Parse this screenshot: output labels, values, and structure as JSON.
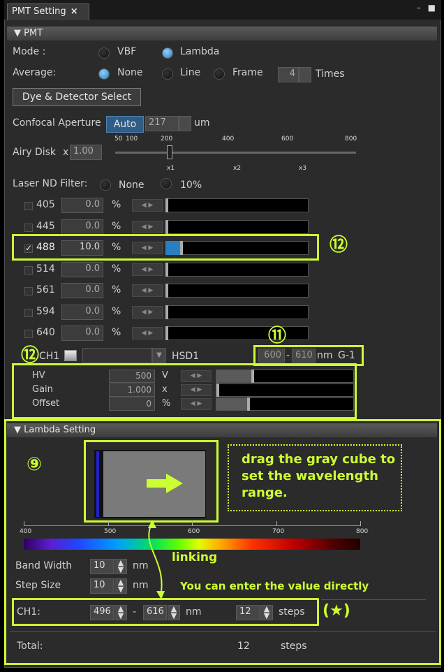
{
  "tab": {
    "title": "PMT Setting",
    "close": "×"
  },
  "window_controls": {
    "min": "–",
    "max": "■"
  },
  "pmt": {
    "section_title": "PMT",
    "mode_label": "Mode :",
    "mode_options": [
      "VBF",
      "Lambda"
    ],
    "mode_selected": "Lambda",
    "average_label": "Average:",
    "average_options": [
      "None",
      "Line",
      "Frame"
    ],
    "average_selected": "None",
    "average_times_value": "4",
    "average_times_unit": "Times",
    "dye_button": "Dye & Detector Select",
    "confocal_label": "Confocal Aperture",
    "confocal_auto": "Auto",
    "confocal_value": "217",
    "confocal_unit": "um",
    "airy_label": "Airy Disk",
    "airy_prefix": "x",
    "airy_value": "1.00",
    "airy_scale_top": [
      "50",
      "100",
      "200",
      "400",
      "600",
      "800"
    ],
    "airy_scale_bottom": [
      "x1",
      "x2",
      "x3"
    ],
    "nd_label": "Laser ND Filter:",
    "nd_options": [
      "None",
      "10%"
    ],
    "nd_selected": "None",
    "lasers": [
      {
        "wavelength": "405",
        "value": "0.0",
        "unit": "%",
        "checked": false,
        "level": 0.0
      },
      {
        "wavelength": "445",
        "value": "0.0",
        "unit": "%",
        "checked": false,
        "level": 0.0
      },
      {
        "wavelength": "488",
        "value": "10.0",
        "unit": "%",
        "checked": true,
        "level": 0.1
      },
      {
        "wavelength": "514",
        "value": "0.0",
        "unit": "%",
        "checked": false,
        "level": 0.0
      },
      {
        "wavelength": "561",
        "value": "0.0",
        "unit": "%",
        "checked": false,
        "level": 0.0
      },
      {
        "wavelength": "594",
        "value": "0.0",
        "unit": "%",
        "checked": false,
        "level": 0.0
      },
      {
        "wavelength": "640",
        "value": "0.0",
        "unit": "%",
        "checked": false,
        "level": 0.0
      }
    ],
    "ch1_label": "CH1",
    "detector": "HSD1",
    "range_from": "600",
    "range_dash": "-",
    "range_to": "610",
    "range_unit": "nm",
    "range_name": "G-1",
    "detector_rows": [
      {
        "label": "HV",
        "value": "500",
        "unit": "V",
        "level": 0.25
      },
      {
        "label": "Gain",
        "value": "1.000",
        "unit": "x",
        "level": 0.0
      },
      {
        "label": "Offset",
        "value": "0",
        "unit": "%",
        "level": 0.22
      }
    ]
  },
  "lambda": {
    "section_title": "Lambda Setting",
    "axis_ticks": [
      "400",
      "500",
      "600",
      "700",
      "800"
    ],
    "band_width_label": "Band Width",
    "band_width_value": "10",
    "band_width_unit": "nm",
    "step_size_label": "Step Size",
    "step_size_value": "10",
    "step_size_unit": "nm",
    "ch1_label": "CH1:",
    "ch1_from": "496",
    "ch1_dash": "-",
    "ch1_to": "616",
    "ch1_unit": "nm",
    "ch1_steps": "12",
    "ch1_steps_unit": "steps",
    "total_label": "Total:",
    "total_value": "12",
    "total_unit": "steps"
  },
  "annotations": {
    "num9": "⑨",
    "num11": "⑪",
    "num12": "⑫",
    "drag_note": "drag the gray cube to set the wavelength range.",
    "linking": "linking",
    "direct_entry": "You can enter the value directly",
    "star": "(★)"
  },
  "colors": {
    "highlight": "#ccff33",
    "panel": "#2b2b2b",
    "radio_on": "#2a7fc0"
  }
}
